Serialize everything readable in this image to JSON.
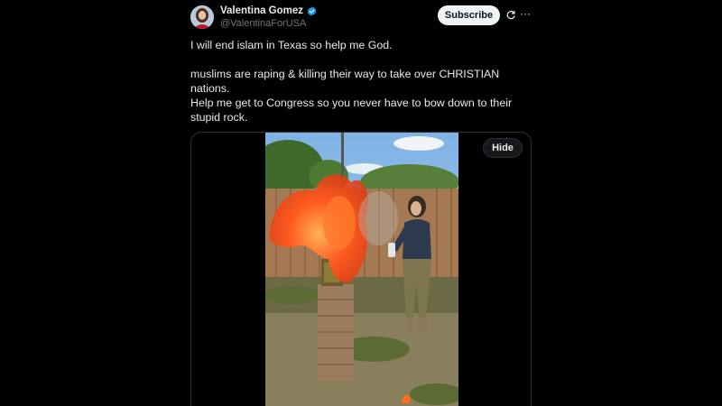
{
  "post": {
    "author": {
      "display_name": "Valentina Gomez",
      "handle": "@ValentinaForUSA",
      "verified": true,
      "verified_color": "#1d9bf0"
    },
    "subscribe_label": "Subscribe",
    "icons": {
      "grok": "grok-icon",
      "more": "more-icon",
      "verified": "verified-badge-icon"
    },
    "more_glyph": "···",
    "text_lines": [
      "I will end islam in Texas so help me God.",
      "muslims are raping & killing their way to take over CHRISTIAN nations.",
      "Help me get to Congress so you never have to bow down to their stupid rock."
    ],
    "media": {
      "hide_label": "Hide"
    }
  },
  "colors": {
    "background": "#000000",
    "text_primary": "#e7e9ea",
    "text_secondary": "#71767b",
    "border": "#2f3336",
    "subscribe_bg": "#eff3f4"
  }
}
